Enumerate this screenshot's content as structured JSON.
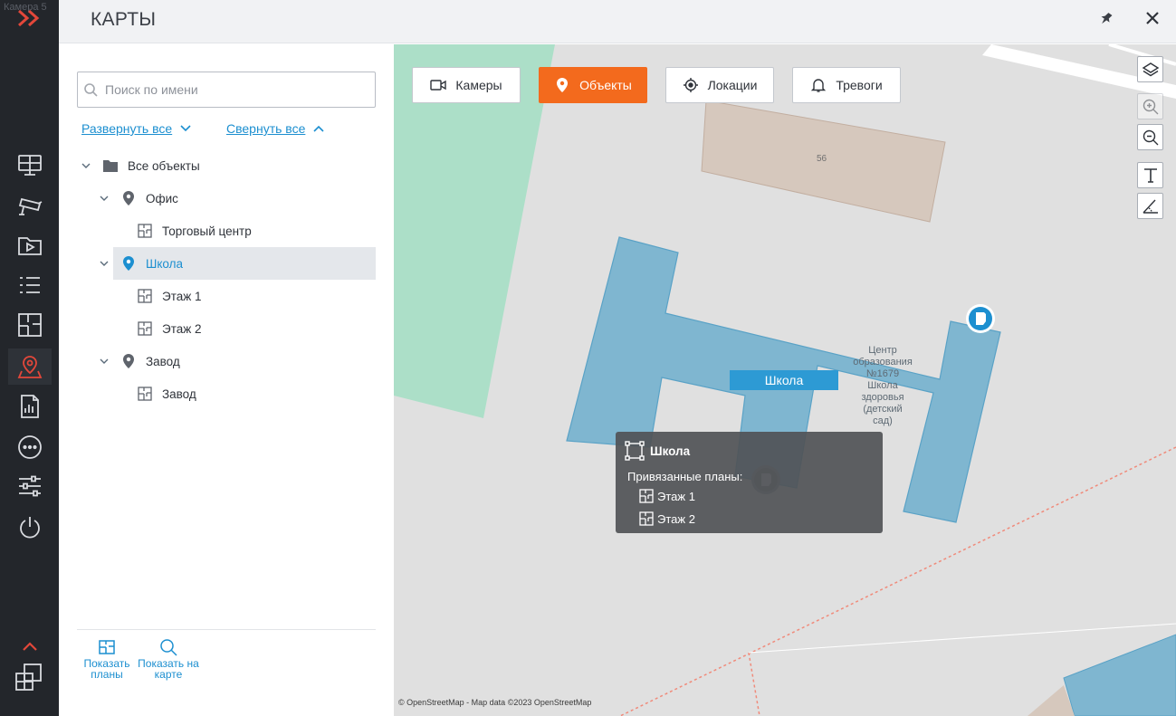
{
  "rail": {
    "camera_label": "Камера 5",
    "items": [
      {
        "name": "monitor-icon"
      },
      {
        "name": "cctv-camera-icon"
      },
      {
        "name": "video-archive-icon"
      },
      {
        "name": "event-list-icon"
      },
      {
        "name": "layout-plan-icon"
      },
      {
        "name": "map-pin-icon",
        "active": true
      },
      {
        "name": "report-icon"
      },
      {
        "name": "more-icon"
      },
      {
        "name": "settings-sliders-icon"
      },
      {
        "name": "power-icon"
      }
    ]
  },
  "header": {
    "title": "КАРТЫ"
  },
  "sidebar": {
    "search_placeholder": "Поиск по имени",
    "expand_all": "Развернуть все",
    "collapse_all": "Свернуть все",
    "tree": [
      {
        "label": "Все объекты",
        "type": "folder",
        "level": 0,
        "expanded": true
      },
      {
        "label": "Офис",
        "type": "object",
        "level": 1,
        "expanded": true
      },
      {
        "label": "Торговый центр",
        "type": "plan",
        "level": 2
      },
      {
        "label": "Школа",
        "type": "object",
        "level": 1,
        "expanded": true,
        "selected": true
      },
      {
        "label": "Этаж 1",
        "type": "plan",
        "level": 2
      },
      {
        "label": "Этаж 2",
        "type": "plan",
        "level": 2
      },
      {
        "label": "Завод",
        "type": "object",
        "level": 1,
        "expanded": true
      },
      {
        "label": "Завод",
        "type": "plan",
        "level": 2
      }
    ],
    "bottom": {
      "show_plans": [
        "Показать",
        "планы"
      ],
      "show_on_map": [
        "Показать на",
        "карте"
      ]
    }
  },
  "map": {
    "filters": [
      {
        "label": "Камеры",
        "icon": "video-camera-icon",
        "active": false
      },
      {
        "label": "Объекты",
        "icon": "map-pin-icon",
        "active": true
      },
      {
        "label": "Локации",
        "icon": "crosshair-icon",
        "active": false
      },
      {
        "label": "Тревоги",
        "icon": "bell-icon",
        "active": false
      }
    ],
    "tools": [
      "layers-icon",
      "zoom-in-icon",
      "zoom-out-icon",
      "text-icon",
      "measure-icon"
    ],
    "building_number": "56",
    "building_tag": "Школа",
    "center_label": [
      "Центр",
      "образования",
      "№1679",
      "Школа",
      "здоровья",
      "(детский",
      "сад)"
    ],
    "tooltip": {
      "title": "Школа",
      "subtitle": "Привязанные планы:",
      "plans": [
        "Этаж 1",
        "Этаж 2"
      ]
    },
    "attribution": "© OpenStreetMap - Map data ©2023 OpenStreetMap",
    "colors": {
      "accent": "#f36a1d",
      "link": "#1c8fd0",
      "building_fill": "#7fb6d0",
      "park": "#acdfc8"
    }
  }
}
